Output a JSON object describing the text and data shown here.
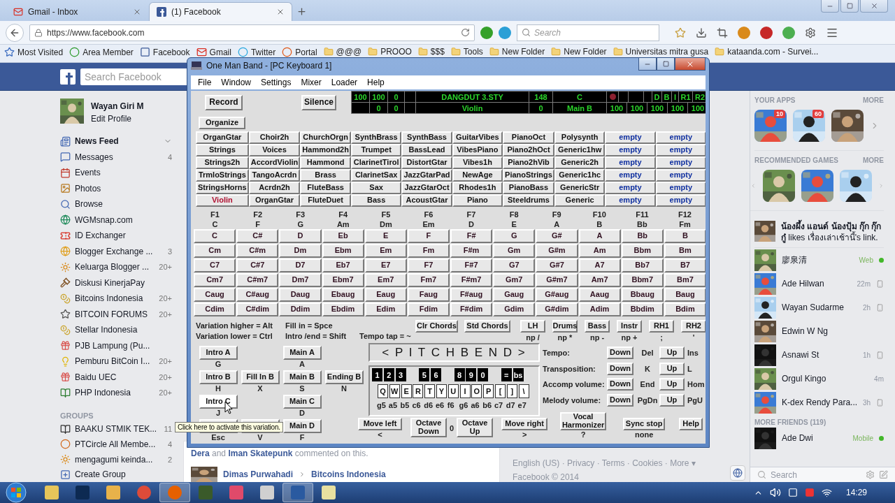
{
  "browser": {
    "tabs": [
      {
        "label": "Gmail - Inbox",
        "selected": false
      },
      {
        "label": "(1) Facebook",
        "selected": true
      }
    ],
    "url": "https://www.facebook.com",
    "search": {
      "placeholder": "Search"
    },
    "bookmarks": [
      "Most Visited",
      "Area Member",
      "Facebook",
      "Gmail",
      "Twitter",
      "Portal",
      "@@@",
      "PROOO",
      "$$$",
      "Tools",
      "New Folder",
      "New Folder",
      "Universitas mitra gusa",
      "kataanda.com - Survei..."
    ]
  },
  "facebook": {
    "search": {
      "placeholder": "Search Facebook"
    },
    "profile": {
      "name": "Wayan Giri M",
      "link": "Edit Profile"
    },
    "nav": [
      {
        "label": "News Feed",
        "selected": true
      },
      {
        "label": "Messages",
        "count": "4",
        "selected": false
      },
      {
        "label": "Events",
        "selected": false
      },
      {
        "label": "Photos",
        "selected": false
      },
      {
        "label": "Browse",
        "selected": false
      },
      {
        "label": "WGMsnap.com",
        "selected": false
      },
      {
        "label": "ID Exchanger",
        "selected": false
      },
      {
        "label": "Blogger Exchange ...",
        "count": "3",
        "selected": false
      },
      {
        "label": "Keluarga Blogger ...",
        "count": "20+",
        "selected": false
      },
      {
        "label": "Diskusi KinerjaPay",
        "selected": false
      },
      {
        "label": "Bitcoins Indonesia",
        "count": "20+",
        "selected": false
      },
      {
        "label": "BITCOIN FORUMS",
        "count": "20+",
        "selected": false
      },
      {
        "label": "Stellar Indonesia",
        "selected": false
      },
      {
        "label": "PJB Lampung (Pu...",
        "selected": false
      },
      {
        "label": "Pemburu BitCoin I...",
        "count": "20+",
        "selected": false
      },
      {
        "label": "Baidu UEC",
        "count": "20+",
        "selected": false
      },
      {
        "label": "PHP Indonesia",
        "count": "20+",
        "selected": false
      }
    ],
    "groups": {
      "heading": "GROUPS",
      "items": [
        {
          "label": "BAAKU STMIK TEK...",
          "count": "11"
        },
        {
          "label": "PTCircle All Membe...",
          "count": "4"
        },
        {
          "label": "mengagumi keinda...",
          "count": "2"
        },
        {
          "label": "Create Group"
        }
      ]
    },
    "feed": {
      "activity": "**Dera** and **Iman Skatepunk** commented on this.",
      "post": {
        "author": "Dimas Purwahadi",
        "group": "Bitcoins Indonesia"
      }
    },
    "footer": {
      "links": "English (US) · Privacy · Terms · Cookies · More ▾",
      "copyright": "Facebook © 2014"
    },
    "right_column": {
      "apps": {
        "heading": "YOUR APPS",
        "more": "MORE",
        "items": [
          {
            "kind": "picture",
            "badge": "10"
          },
          {
            "kind": "picture",
            "badge": "60"
          },
          {
            "kind": "picture"
          }
        ]
      },
      "games": {
        "heading": "RECOMMENDED GAMES",
        "more": "MORE",
        "items": [
          {
            "kind": "picture"
          },
          {
            "kind": "picture"
          },
          {
            "kind": "picture"
          }
        ]
      },
      "ticker": "**น้องผึ้ง แอนด์ น้องปุ้ม กุ๊ก กุ๊กกู๋** likes เรื่องเล่าเช้านี้'s link.",
      "chat": [
        {
          "name": "廖泉清",
          "status": "Web",
          "kind": "web"
        },
        {
          "name": "Ade Hilwan",
          "status": "22m",
          "kind": "phone"
        },
        {
          "name": "Wayan Sudarme",
          "status": "2h",
          "kind": "phone"
        },
        {
          "name": "Edwin W Ng",
          "kind": "none"
        },
        {
          "name": "Asnawi St",
          "status": "1h",
          "kind": "phone"
        },
        {
          "name": "Orgul Kingo",
          "status": "4m",
          "kind": "idle"
        },
        {
          "name": "K-dex Rendy Para...",
          "status": "3h",
          "kind": "phone"
        }
      ],
      "more_friends": {
        "heading": "MORE FRIENDS (119)",
        "items": [
          {
            "name": "Ade Dwi",
            "status": "Mobile",
            "kind": "mobile"
          }
        ]
      },
      "search": {
        "placeholder": "Search"
      }
    }
  },
  "app": {
    "title": "One Man Band - [PC Keyboard 1]",
    "menu": [
      "File",
      "Window",
      "Settings",
      "Mixer",
      "Loader",
      "Help"
    ],
    "record": "Record",
    "silence": "Silence",
    "display": {
      "top": {
        "levels": [
          "100",
          "100",
          "0"
        ],
        "style": "DANGDUT 3.STY",
        "tempo": "148",
        "key": "C",
        "record_led": true,
        "flags": [
          "D",
          "B",
          "I",
          "R1",
          "R2"
        ]
      },
      "bottom": {
        "levels": [
          "0",
          "0"
        ],
        "voice": "Violin",
        "transpose": "0",
        "variation": "Main B",
        "volumes": [
          "100",
          "100",
          "100",
          "100",
          "100"
        ]
      }
    },
    "organize": "Organize",
    "voices": [
      [
        {
          "label": "OrganGtar",
          "kind": "voice",
          "selected": false
        },
        {
          "label": "Choir2h",
          "kind": "voice",
          "selected": false
        },
        {
          "label": "ChurchOrgn",
          "kind": "voice",
          "selected": false
        },
        {
          "label": "SynthBrass",
          "kind": "voice",
          "selected": false
        },
        {
          "label": "SynthBass",
          "kind": "voice",
          "selected": false
        },
        {
          "label": "GuitarVibes",
          "kind": "voice",
          "selected": false
        },
        {
          "label": "PianoOct",
          "kind": "voice",
          "selected": false
        },
        {
          "label": "Polysynth",
          "kind": "voice",
          "selected": false
        },
        {
          "label": "empty",
          "kind": "empty",
          "selected": false
        },
        {
          "label": "empty",
          "kind": "empty",
          "selected": false
        }
      ],
      [
        {
          "label": "Strings",
          "kind": "voice",
          "selected": false
        },
        {
          "label": "Voices",
          "kind": "voice",
          "selected": false
        },
        {
          "label": "Hammond2h",
          "kind": "voice",
          "selected": false
        },
        {
          "label": "Trumpet",
          "kind": "voice",
          "selected": false
        },
        {
          "label": "BassLead",
          "kind": "voice",
          "selected": false
        },
        {
          "label": "VibesPiano",
          "kind": "voice",
          "selected": false
        },
        {
          "label": "Piano2hOct",
          "kind": "voice",
          "selected": false
        },
        {
          "label": "Generic1hw",
          "kind": "voice",
          "selected": false
        },
        {
          "label": "empty",
          "kind": "empty",
          "selected": false
        },
        {
          "label": "empty",
          "kind": "empty",
          "selected": false
        }
      ],
      [
        {
          "label": "Strings2h",
          "kind": "voice",
          "selected": false
        },
        {
          "label": "AccordViolin",
          "kind": "voice",
          "selected": false
        },
        {
          "label": "Hammond",
          "kind": "voice",
          "selected": false
        },
        {
          "label": "ClarinetTirol",
          "kind": "voice",
          "selected": false
        },
        {
          "label": "DistortGtar",
          "kind": "voice",
          "selected": false
        },
        {
          "label": "Vibes1h",
          "kind": "voice",
          "selected": false
        },
        {
          "label": "Piano2hVib",
          "kind": "voice",
          "selected": false
        },
        {
          "label": "Generic2h",
          "kind": "voice",
          "selected": false
        },
        {
          "label": "empty",
          "kind": "empty",
          "selected": false
        },
        {
          "label": "empty",
          "kind": "empty",
          "selected": false
        }
      ],
      [
        {
          "label": "TrmloStrings",
          "kind": "voice",
          "selected": false
        },
        {
          "label": "TangoAcrdn",
          "kind": "voice",
          "selected": false
        },
        {
          "label": "Brass",
          "kind": "voice",
          "selected": false
        },
        {
          "label": "ClarinetSax",
          "kind": "voice",
          "selected": false
        },
        {
          "label": "JazzGtarPad",
          "kind": "voice",
          "selected": false
        },
        {
          "label": "NewAge",
          "kind": "voice",
          "selected": false
        },
        {
          "label": "PianoStrings",
          "kind": "voice",
          "selected": false
        },
        {
          "label": "Generic1hc",
          "kind": "voice",
          "selected": false
        },
        {
          "label": "empty",
          "kind": "empty",
          "selected": false
        },
        {
          "label": "empty",
          "kind": "empty",
          "selected": false
        }
      ],
      [
        {
          "label": "StringsHorns",
          "kind": "voice",
          "selected": false
        },
        {
          "label": "Acrdn2h",
          "kind": "voice",
          "selected": false
        },
        {
          "label": "FluteBass",
          "kind": "voice",
          "selected": false
        },
        {
          "label": "Sax",
          "kind": "voice",
          "selected": false
        },
        {
          "label": "JazzGtarOct",
          "kind": "voice",
          "selected": false
        },
        {
          "label": "Rhodes1h",
          "kind": "voice",
          "selected": false
        },
        {
          "label": "PianoBass",
          "kind": "voice",
          "selected": false
        },
        {
          "label": "GenericStr",
          "kind": "voice",
          "selected": false
        },
        {
          "label": "empty",
          "kind": "empty",
          "selected": false
        },
        {
          "label": "empty",
          "kind": "empty",
          "selected": false
        }
      ],
      [
        {
          "label": "Violin",
          "kind": "voice",
          "selected": true
        },
        {
          "label": "OrganGtar",
          "kind": "voice",
          "selected": false
        },
        {
          "label": "FluteDuet",
          "kind": "voice",
          "selected": false
        },
        {
          "label": "Bass",
          "kind": "voice",
          "selected": false
        },
        {
          "label": "AcoustGtar",
          "kind": "voice",
          "selected": false
        },
        {
          "label": "Piano",
          "kind": "voice",
          "selected": false
        },
        {
          "label": "Steeldrums",
          "kind": "voice",
          "selected": false
        },
        {
          "label": "Generic",
          "kind": "voice",
          "selected": false
        },
        {
          "label": "empty",
          "kind": "empty",
          "selected": false
        },
        {
          "label": "empty",
          "kind": "empty",
          "selected": false
        }
      ]
    ],
    "function_keys": [
      {
        "key": "F1",
        "chord": "C"
      },
      {
        "key": "F2",
        "chord": "F"
      },
      {
        "key": "F3",
        "chord": "G"
      },
      {
        "key": "F4",
        "chord": "Am"
      },
      {
        "key": "F5",
        "chord": "Dm"
      },
      {
        "key": "F6",
        "chord": "Em"
      },
      {
        "key": "F7",
        "chord": "D"
      },
      {
        "key": "F8",
        "chord": "E"
      },
      {
        "key": "F9",
        "chord": "A"
      },
      {
        "key": "F10",
        "chord": "B"
      },
      {
        "key": "F11",
        "chord": "Bb"
      },
      {
        "key": "F12",
        "chord": "Fm"
      }
    ],
    "chords": [
      [
        "C",
        "C#",
        "D",
        "Eb",
        "E",
        "F",
        "F#",
        "G",
        "G#",
        "A",
        "Bb",
        "B"
      ],
      [
        "Cm",
        "C#m",
        "Dm",
        "Ebm",
        "Em",
        "Fm",
        "F#m",
        "Gm",
        "G#m",
        "Am",
        "Bbm",
        "Bm"
      ],
      [
        "C7",
        "C#7",
        "D7",
        "Eb7",
        "E7",
        "F7",
        "F#7",
        "G7",
        "G#7",
        "A7",
        "Bb7",
        "B7"
      ],
      [
        "Cm7",
        "C#m7",
        "Dm7",
        "Ebm7",
        "Em7",
        "Fm7",
        "F#m7",
        "Gm7",
        "G#m7",
        "Am7",
        "Bbm7",
        "Bm7"
      ],
      [
        "Caug",
        "C#aug",
        "Daug",
        "Ebaug",
        "Eaug",
        "Faug",
        "F#aug",
        "Gaug",
        "G#aug",
        "Aaug",
        "Bbaug",
        "Baug"
      ],
      [
        "Cdim",
        "C#dim",
        "Ddim",
        "Ebdim",
        "Edim",
        "Fdim",
        "F#dim",
        "Gdim",
        "G#dim",
        "Adim",
        "Bbdim",
        "Bdim"
      ]
    ],
    "hints": [
      [
        "Variation higher = Alt",
        "Fill in = Spce"
      ],
      [
        "Variation lower = Ctrl",
        "Intro /end = Shift",
        "Tempo tap = ~"
      ]
    ],
    "chord_buttons": [
      "Clr Chords",
      "Std Chords"
    ],
    "parts": [
      {
        "label": "LH",
        "key": "np /"
      },
      {
        "label": "Drums",
        "key": "np *"
      },
      {
        "label": "Bass",
        "key": "np -"
      },
      {
        "label": "Instr",
        "key": "np +"
      },
      {
        "label": "RH1",
        "key": ";"
      },
      {
        "label": "RH2",
        "key": "'"
      }
    ],
    "variations": [
      [
        {
          "kind": "button",
          "label": "Intro A",
          "key": "G",
          "hovered": false
        },
        {
          "kind": "gap"
        },
        {
          "kind": "button",
          "label": "Main A",
          "key": "A",
          "hovered": false
        },
        {
          "kind": "gap"
        }
      ],
      [
        {
          "kind": "button",
          "label": "Intro B",
          "key": "H",
          "hovered": false
        },
        {
          "kind": "button",
          "label": "Fill In B",
          "key": "X",
          "hovered": false
        },
        {
          "kind": "button",
          "label": "Main B",
          "key": "S",
          "hovered": false
        },
        {
          "kind": "button",
          "label": "Ending B",
          "key": "N",
          "hovered": false
        }
      ],
      [
        {
          "kind": "button",
          "label": "Intro C",
          "key": "J",
          "hovered": true
        },
        {
          "kind": "gap"
        },
        {
          "kind": "button",
          "label": "Main C",
          "key": "D",
          "hovered": false
        },
        {
          "kind": "gap"
        }
      ],
      [
        {
          "kind": "button",
          "key": "Esc",
          "hovered": false
        },
        {
          "kind": "button",
          "key": "V",
          "hovered": false
        },
        {
          "kind": "button",
          "label": "Main D",
          "key": "F",
          "hovered": false
        },
        {
          "kind": "gap"
        }
      ]
    ],
    "pitch_bend": "< P I T C H B E N D >",
    "number_keys": [
      {
        "kind": "key",
        "label": "1"
      },
      {
        "kind": "key",
        "label": "2"
      },
      {
        "kind": "key",
        "label": "3"
      },
      {
        "kind": "gap"
      },
      {
        "kind": "key",
        "label": "5"
      },
      {
        "kind": "key",
        "label": "6"
      },
      {
        "kind": "gap"
      },
      {
        "kind": "key",
        "label": "8"
      },
      {
        "kind": "key",
        "label": "9"
      },
      {
        "kind": "key",
        "label": "0"
      },
      {
        "kind": "gap"
      },
      {
        "kind": "key",
        "label": "="
      },
      {
        "kind": "key",
        "label": "bs"
      }
    ],
    "letter_keys": [
      "Q",
      "W",
      "E",
      "R",
      "T",
      "Y",
      "U",
      "I",
      "O",
      "P",
      "[",
      "]",
      "\\"
    ],
    "notes": [
      "g5",
      "a5",
      "b5",
      "c6",
      "d6",
      "e6",
      "f6",
      "g6",
      "a6",
      "b6",
      "c7",
      "d7",
      "e7"
    ],
    "controls": [
      {
        "label": "Tempo:",
        "down": "Down",
        "down_key": "Del",
        "up": "Up",
        "up_key": "Ins"
      },
      {
        "label": "Transposition:",
        "down": "Down",
        "down_key": "K",
        "up": "Up",
        "up_key": "L"
      },
      {
        "label": "Accomp volume:",
        "down": "Down",
        "down_key": "End",
        "up": "Up",
        "up_key": "Hom"
      },
      {
        "label": "Melody volume:",
        "down": "Down",
        "down_key": "PgDn",
        "up": "Up",
        "up_key": "PgU"
      }
    ],
    "bottom": {
      "move_left": {
        "label": "Move left",
        "key": "<"
      },
      "octave_down": "Octave Down",
      "octave": "0",
      "octave_up": "Octave Up",
      "move_right": {
        "label": "Move right",
        "key": ">"
      },
      "harmonizer": {
        "label": "Vocal Harmonizer",
        "key": "?"
      },
      "sync": {
        "label": "Sync stop",
        "key": "none"
      },
      "help": "Help"
    }
  },
  "tooltip": "Click here to activate this variation.",
  "taskbar": {
    "time": "14:29"
  }
}
